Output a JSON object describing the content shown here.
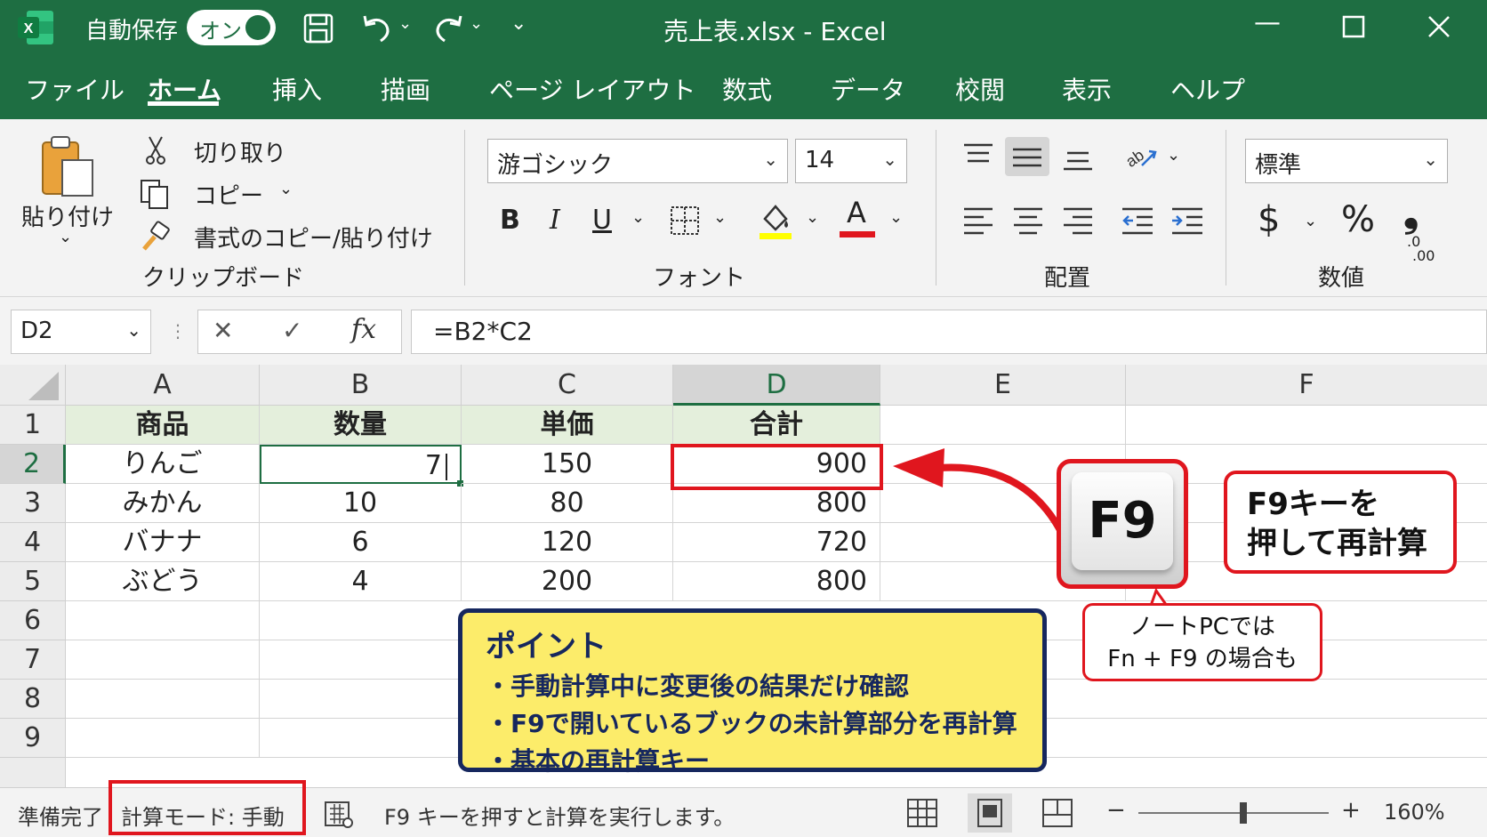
{
  "window": {
    "autosave_label": "自動保存",
    "autosave_state": "オン",
    "title": "売上表.xlsx  -  Excel"
  },
  "tabs": [
    "ファイル",
    "ホーム",
    "挿入",
    "描画",
    "ページ レイアウト",
    "数式",
    "データ",
    "校閲",
    "表示",
    "ヘルプ"
  ],
  "ribbon": {
    "clipboard": {
      "paste": "貼り付け",
      "cut": "切り取り",
      "copy": "コピー",
      "format_painter": "書式のコピー/貼り付け",
      "label": "クリップボード"
    },
    "font": {
      "name": "游ゴシック",
      "size": "14",
      "bold": "B",
      "italic": "I",
      "underline": "U",
      "font_color_glyph": "A",
      "label": "フォント"
    },
    "alignment": {
      "label": "配置"
    },
    "number": {
      "format": "標準",
      "currency": "$",
      "percent": "%",
      "comma": "❟",
      "decimal_top": ".0",
      "decimal_bottom": ".00",
      "label": "数値"
    }
  },
  "formula_bar": {
    "name_box": "D2",
    "cancel": "✕",
    "enter": "✓",
    "fx": "fx",
    "formula": "=B2*C2"
  },
  "grid": {
    "columns": [
      "A",
      "B",
      "C",
      "D",
      "E",
      "F"
    ],
    "rows": [
      "1",
      "2",
      "3",
      "4",
      "5",
      "6",
      "7",
      "8",
      "9"
    ],
    "headers": [
      "商品",
      "数量",
      "単価",
      "合計"
    ],
    "data": [
      [
        "りんご",
        "7",
        "150",
        "900"
      ],
      [
        "みかん",
        "10",
        "80",
        "800"
      ],
      [
        "バナナ",
        "6",
        "120",
        "720"
      ],
      [
        "ぶどう",
        "4",
        "200",
        "800"
      ]
    ]
  },
  "status_bar": {
    "ready": "準備完了",
    "calc_mode": "計算モード: 手動",
    "message": "F9 キーを押すと計算を実行します。",
    "minus": "−",
    "plus": "+",
    "zoom": "160%",
    "zoom_fraction": 0.55
  },
  "annotations": {
    "point_title": "ポイント",
    "point_items": [
      "・手動計算中に変更後の結果だけ確認",
      "・F9で開いているブックの未計算部分を再計算",
      "・基本の再計算キー"
    ],
    "key_label": "F9",
    "callout_line1": "F9キーを",
    "callout_line2": "押して再計算",
    "note_line1": "ノートPCでは",
    "note_line2": "Fn + F9 の場合も"
  },
  "colors": {
    "excel_green": "#1e6e42",
    "highlight_red": "#e0161e",
    "point_yellow": "#fcec6a",
    "point_navy": "#16275e",
    "header_fill": "#e4efdc"
  }
}
